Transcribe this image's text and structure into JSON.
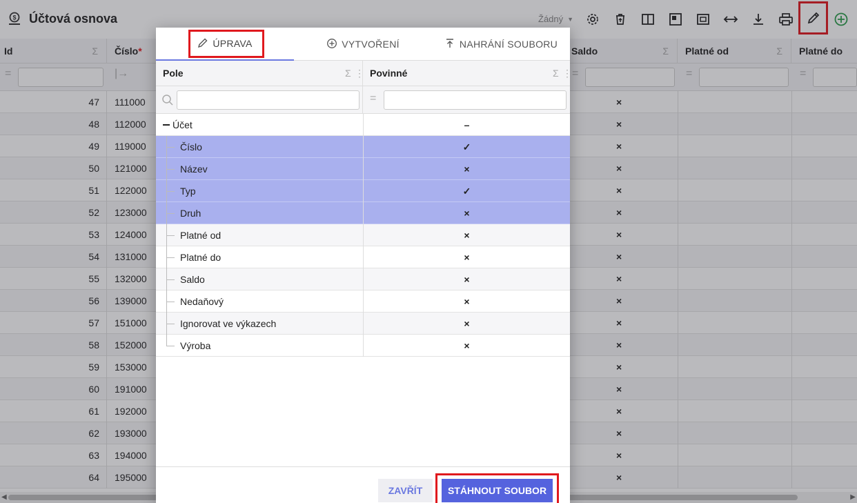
{
  "header": {
    "title": "Účtová osnova",
    "selector": "Žádný"
  },
  "toolbar": {
    "icons": [
      "gear-icon",
      "delete-icon",
      "columns-icon",
      "layout-icon",
      "fit-icon",
      "resize-icon",
      "download-icon",
      "print-icon",
      "edit-icon",
      "add-icon"
    ]
  },
  "grid": {
    "columns": [
      "Id",
      "Číslo",
      "Saldo",
      "Platné od",
      "Platné do"
    ],
    "required_marker": "*",
    "sum_symbol": "Σ",
    "rows": [
      {
        "id": "47",
        "num": "111000"
      },
      {
        "id": "48",
        "num": "112000"
      },
      {
        "id": "49",
        "num": "119000"
      },
      {
        "id": "50",
        "num": "121000"
      },
      {
        "id": "51",
        "num": "122000"
      },
      {
        "id": "52",
        "num": "123000"
      },
      {
        "id": "53",
        "num": "124000"
      },
      {
        "id": "54",
        "num": "131000"
      },
      {
        "id": "55",
        "num": "132000"
      },
      {
        "id": "56",
        "num": "139000"
      },
      {
        "id": "57",
        "num": "151000"
      },
      {
        "id": "58",
        "num": "152000"
      },
      {
        "id": "59",
        "num": "153000"
      },
      {
        "id": "60",
        "num": "191000"
      },
      {
        "id": "61",
        "num": "192000"
      },
      {
        "id": "62",
        "num": "193000"
      },
      {
        "id": "63",
        "num": "194000"
      },
      {
        "id": "64",
        "num": "195000"
      }
    ],
    "saldo_mark": "×"
  },
  "dialog": {
    "tabs": [
      {
        "label": "ÚPRAVA",
        "icon": "pencil-icon",
        "active": true
      },
      {
        "label": "VYTVOŘENÍ",
        "icon": "plus-circle-icon",
        "active": false
      },
      {
        "label": "NAHRÁNÍ SOUBORU",
        "icon": "upload-icon",
        "active": false
      }
    ],
    "columns": {
      "field": "Pole",
      "required": "Povinné"
    },
    "tree": [
      {
        "name": "Účet",
        "mark": "–",
        "level": 0,
        "selected": false
      },
      {
        "name": "Číslo",
        "mark": "✓",
        "level": 1,
        "selected": true
      },
      {
        "name": "Název",
        "mark": "×",
        "level": 1,
        "selected": true
      },
      {
        "name": "Typ",
        "mark": "✓",
        "level": 1,
        "selected": true
      },
      {
        "name": "Druh",
        "mark": "×",
        "level": 1,
        "selected": true
      },
      {
        "name": "Platné od",
        "mark": "×",
        "level": 1,
        "selected": false
      },
      {
        "name": "Platné do",
        "mark": "×",
        "level": 1,
        "selected": false
      },
      {
        "name": "Saldo",
        "mark": "×",
        "level": 1,
        "selected": false
      },
      {
        "name": "Nedaňový",
        "mark": "×",
        "level": 1,
        "selected": false
      },
      {
        "name": "Ignorovat ve výkazech",
        "mark": "×",
        "level": 1,
        "selected": false
      },
      {
        "name": "Výroba",
        "mark": "×",
        "level": 1,
        "selected": false
      }
    ],
    "buttons": {
      "close": "ZAVŘÍT",
      "download": "STÁHNOUT SOUBOR"
    }
  },
  "colors": {
    "accent": "#5563de",
    "selected_row": "#a9b0ee",
    "highlight": "#e0191e",
    "add_icon": "#2a9d4a"
  }
}
